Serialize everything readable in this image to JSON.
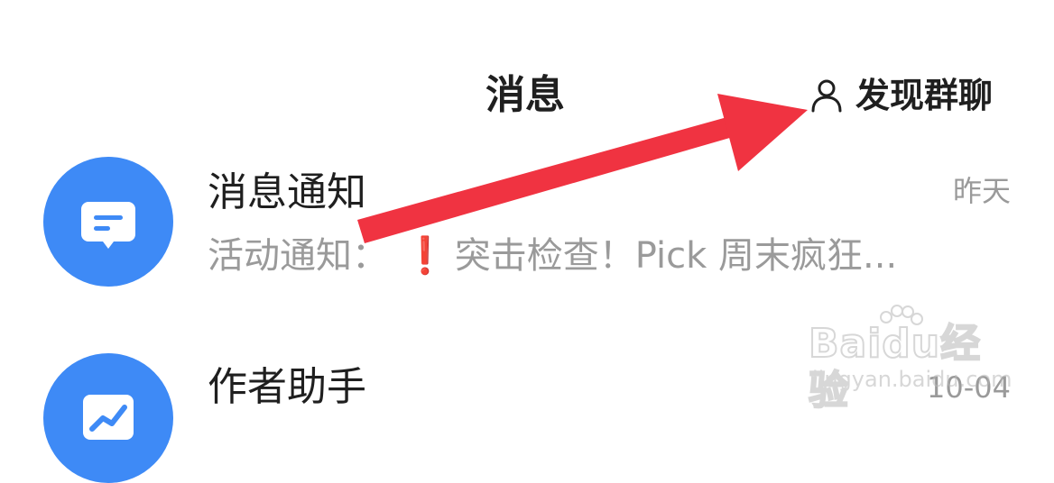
{
  "header": {
    "title": "消息",
    "discover_icon": "person-icon",
    "discover_label": "发现群聊"
  },
  "messages": [
    {
      "icon": "chat-bubble-icon",
      "title": "消息通知",
      "time": "昨天",
      "preview_prefix": "活动通知：",
      "preview_mark": "❗",
      "preview_text": "突击检查！Pick 周末疯狂..."
    },
    {
      "icon": "trend-chart-icon",
      "title": "作者助手",
      "time": "10-04"
    }
  ],
  "watermark": {
    "brand": "Baidu经验",
    "site": "jingyan.baidu.com"
  },
  "colors": {
    "avatar_blue": "#3e8af6",
    "arrow_red": "#f03341",
    "text_primary": "#1f1f1f",
    "text_secondary": "#9a9a9a"
  }
}
